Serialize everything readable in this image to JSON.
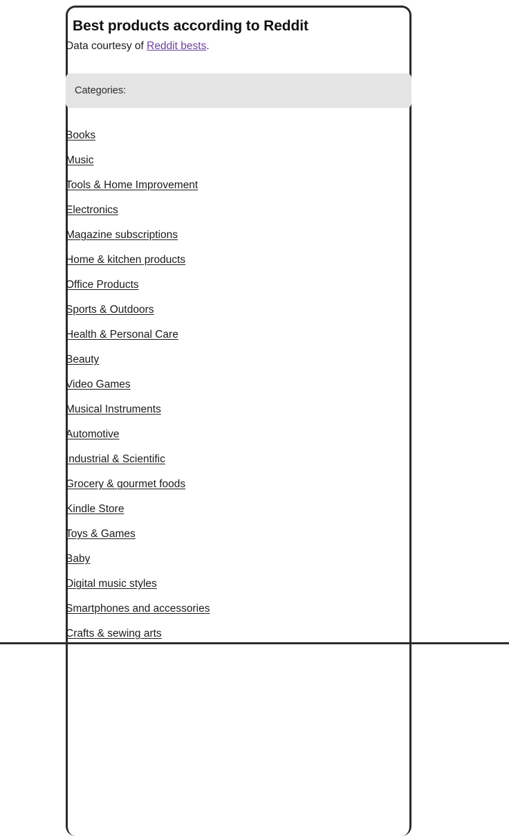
{
  "page": {
    "title": "Best products according to Reddit",
    "subtitle_prefix": "Data courtesy of ",
    "subtitle_link": "Reddit bests",
    "subtitle_suffix": "."
  },
  "categories_panel": {
    "label": "Categories:"
  },
  "categories": [
    {
      "label": "Books"
    },
    {
      "label": "Music"
    },
    {
      "label": "Tools & Home Improvement"
    },
    {
      "label": "Electronics"
    },
    {
      "label": "Magazine subscriptions"
    },
    {
      "label": "Home & kitchen products"
    },
    {
      "label": "Office Products"
    },
    {
      "label": "Sports & Outdoors"
    },
    {
      "label": "Health & Personal Care"
    },
    {
      "label": "Beauty"
    },
    {
      "label": "Video Games"
    },
    {
      "label": "Musical Instruments"
    },
    {
      "label": "Automotive"
    },
    {
      "label": "Industrial & Scientific"
    },
    {
      "label": "Grocery & gourmet foods"
    },
    {
      "label": "Kindle Store"
    },
    {
      "label": "Toys & Games"
    },
    {
      "label": "Baby"
    },
    {
      "label": "Digital music styles"
    },
    {
      "label": "Smartphones and accessories"
    },
    {
      "label": "Crafts & sewing arts"
    }
  ],
  "colors": {
    "card_border": "#2b2b2b",
    "panel_background": "#e4e4e4",
    "link_text": "#1b1b1b",
    "credit_link": "#6b3fa0",
    "page_background": "#ffffff"
  }
}
